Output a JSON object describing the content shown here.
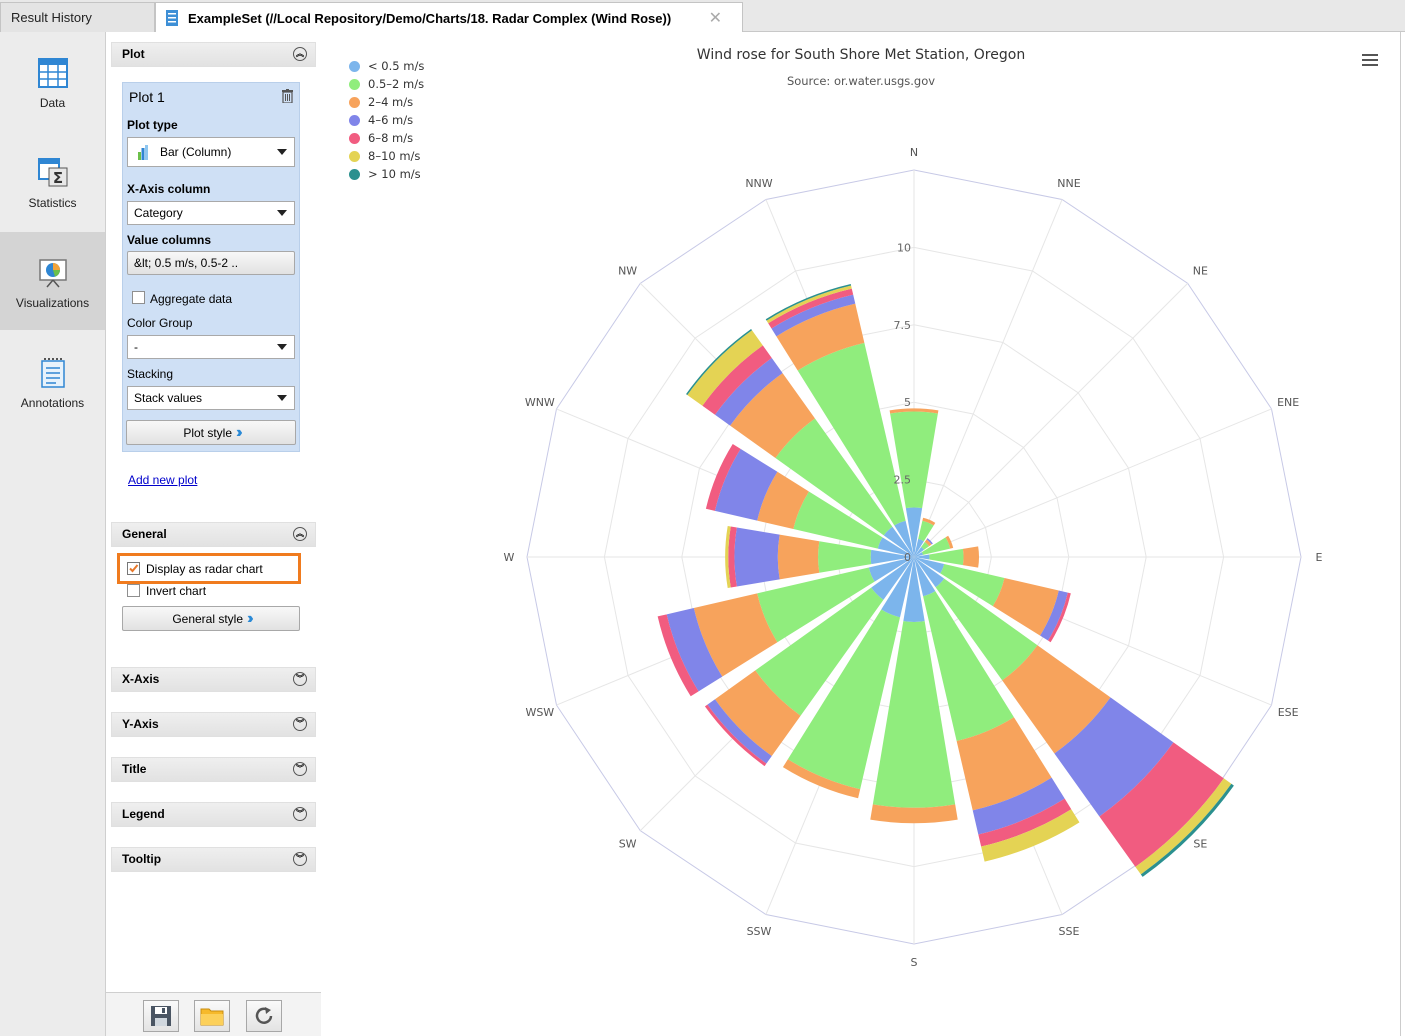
{
  "tabs": [
    {
      "label": "Result History",
      "active": false
    },
    {
      "label": "ExampleSet (//Local Repository/Demo/Charts/18. Radar Complex (Wind Rose))",
      "active": true
    }
  ],
  "nav": [
    {
      "label": "Data",
      "icon": "table-icon"
    },
    {
      "label": "Statistics",
      "icon": "sigma-icon"
    },
    {
      "label": "Visualizations",
      "icon": "presentation-chart-icon",
      "selected": true
    },
    {
      "label": "Annotations",
      "icon": "notepad-icon"
    }
  ],
  "panel": {
    "plot_section": "Plot",
    "plot_name": "Plot 1",
    "plot_type_label": "Plot type",
    "plot_type_value": "Bar (Column)",
    "x_axis_label": "X-Axis column",
    "x_axis_value": "Category",
    "value_columns_label": "Value columns",
    "value_columns_value": "&lt; 0.5 m/s, 0.5-2 ..",
    "aggregate_label": "Aggregate data",
    "color_group_label": "Color Group",
    "color_group_value": "-",
    "stacking_label": "Stacking",
    "stacking_value": "Stack values",
    "plot_style_button": "Plot style",
    "add_plot_link": "Add new plot",
    "general_section": "General",
    "radar_label": "Display as radar chart",
    "radar_checked": true,
    "invert_label": "Invert chart",
    "invert_checked": false,
    "general_style_button": "General style",
    "collapsed_sections": [
      "X-Axis",
      "Y-Axis",
      "Title",
      "Legend",
      "Tooltip"
    ]
  },
  "chart_data": {
    "type": "bar",
    "polar": true,
    "stacked": true,
    "title": "Wind rose for South Shore Met Station, Oregon",
    "subtitle": "Source: or.water.usgs.gov",
    "legend_position": "top-left",
    "radial_ticks": [
      "0",
      "2.5",
      "5",
      "7.5",
      "10"
    ],
    "radial_max": 12.5,
    "categories": [
      "N",
      "NNE",
      "NE",
      "ENE",
      "E",
      "ESE",
      "SE",
      "SSE",
      "S",
      "SSW",
      "SW",
      "WSW",
      "W",
      "WNW",
      "NW",
      "NNW"
    ],
    "series": [
      {
        "name": "< 0.5 m/s",
        "color": "#7cb5ec",
        "values": [
          1.6,
          0.6,
          0.4,
          0.3,
          0.5,
          1.0,
          1.2,
          1.3,
          2.1,
          2.0,
          1.7,
          1.5,
          1.4,
          1.2,
          1.2,
          1.2
        ]
      },
      {
        "name": "0.5–2 m/s",
        "color": "#90ed7d",
        "values": [
          3.1,
          0.6,
          0.2,
          0.9,
          1.1,
          2.0,
          3.7,
          4.8,
          6.0,
          5.7,
          4.6,
          3.7,
          1.7,
          2.8,
          4.3,
          5.9
        ]
      },
      {
        "name": "2–4 m/s",
        "color": "#f7a35c",
        "values": [
          0.1,
          0.1,
          0.1,
          0.1,
          0.5,
          1.8,
          2.9,
          2.3,
          0.5,
          0.3,
          1.6,
          2.1,
          1.3,
          1.2,
          1.8,
          1.3
        ]
      },
      {
        "name": "4–6 m/s",
        "color": "#8085e9",
        "values": [
          0,
          0,
          0.05,
          0,
          0,
          0.3,
          2.5,
          0.8,
          0,
          0,
          0.3,
          0.9,
          1.4,
          1.4,
          0.6,
          0.3
        ]
      },
      {
        "name": "6–8 m/s",
        "color": "#f15c80",
        "values": [
          0,
          0,
          0,
          0,
          0,
          0.1,
          2.0,
          0.4,
          0,
          0,
          0.1,
          0.3,
          0.2,
          0.3,
          0.5,
          0.2
        ]
      },
      {
        "name": "8–10 m/s",
        "color": "#e4d354",
        "values": [
          0,
          0,
          0,
          0,
          0,
          0,
          0.3,
          0.5,
          0,
          0,
          0,
          0,
          0.1,
          0,
          0.6,
          0.1
        ]
      },
      {
        "name": "> 10 m/s",
        "color": "#2b908f",
        "values": [
          0,
          0,
          0,
          0,
          0,
          0,
          0.1,
          0,
          0,
          0,
          0,
          0,
          0,
          0,
          0.05,
          0.05
        ]
      }
    ]
  }
}
